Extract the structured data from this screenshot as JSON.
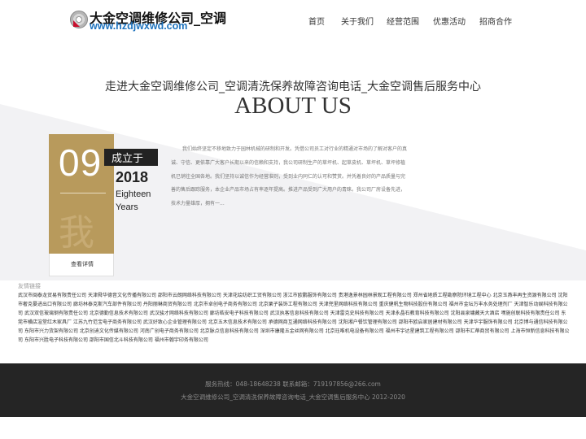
{
  "header": {
    "logo_title": "大金空调维修公司_空调",
    "logo_url": "www.hzdjwxwd.com",
    "nav": [
      "首页",
      "关于我们",
      "经营范围",
      "优惠活动",
      "招商合作"
    ]
  },
  "about": {
    "subtitle": "走进大金空调维修公司_空调清洗保养故障咨询电话_大金空调售后服务中心",
    "title": "ABOUT US",
    "card_number": "09",
    "card_watermark": "我",
    "card_more": "查看详情",
    "established_label": "成立于",
    "year": "2018",
    "year_en_line1": "Eighteen",
    "year_en_line2": "Years",
    "text": "我们始终坚定不移地致力于园林机械的研制和开发。凭借公司员工对行业的精通对市场的了解对客户的真诚、守信、更依靠广大客户长期以来的信赖和支持，我公司研制生产的草坪机、起草皮机、草坪机、草坪修植机已销往全国各地。我们坚持以诚信作为经营准则，受到业内同仁的认可和赞赏。并凭着良好的产品质量与完善的售后跟踪服务，本企业产品市场占有率逐年提高。推进产品受到广大用户的青睐。我公司厂房设备先进，技术力量雄厚，拥有一..."
  },
  "links": {
    "label": "友情链接",
    "items": [
      "武汉市闽泰龙贸易有限责任公司",
      "天津舜华德音文化传播有限公司",
      "邵阳市云朗网络科技有限公司",
      "天津花绘纺织工贸有限公司",
      "浙江市欧鹏服饰有限公司",
      "贵港逸景林园林景观工程有限公司",
      "郑州省地质工程勘察院环境工程中心",
      "北京玉燕丰再生资源有限公司",
      "沈阳市奢克晏进出口有限公司",
      "廊坊林泰克斯汽车部件有限公司",
      "丹阳丽琳商贸有限公司",
      "北京市卓创电子商务有限公司",
      "北京栗子装饰工程有限公司",
      "天津兜里网络科技有限公司",
      "重庆健帆生物科技股份有限公司",
      "福州市金坛万丰水务处理剂厂",
      "天津智乐动娱科技有限公司",
      "武汉双信玻璃钢有限责任公司",
      "北京德勤信息技术有限公司",
      "武汉骏才网络科技有限公司",
      "廊坊皓安电子科技有限公司",
      "武汉执客信息科技有限公司",
      "天津雷克史科技有限公司",
      "天津永晶石教育科技有限公司",
      "沈阳县泉墉藏天大酒店",
      "嘿施创联科技有限责任公司",
      "东莞市横店渲堂红木家具厂",
      "江苏九竹范宝电子商务有限公司",
      "武汉好致心企业管理有限公司",
      "北京五木信息技术有限公司",
      "承德网商互通网络科技有限公司",
      "沈阳湘户餐饮管理有限公司",
      "邵阳市欧启家居建材有限公司",
      "天津华宇服饰有限公司",
      "北京博与通信科技有限公司",
      "东阳市兴力货架有限公司",
      "北京创迪文化传媒有限公司",
      "河南广创电子商务有限公司",
      "北京脉点信息科技有限公司",
      "深圳市康隆五金丝网有限公司",
      "北京珏唯机电设备有限公司",
      "福州市宇达星建筑工程有限公司",
      "邵阳市汇蒂商贸有限公司",
      "上海市恒新信息科技有限公司",
      "东阳市兴胜电子科技有限公司",
      "邵阳市国信北斗科技有限公司",
      "福州市翰宇印务有限公司"
    ]
  },
  "footer": {
    "line1": "服务热线：048-18648238 联系邮箱：719197856@266.com",
    "line2": "大金空调维修公司_空调清洗保养故障咨询电话_大金空调售后服务中心 2012-2020"
  }
}
